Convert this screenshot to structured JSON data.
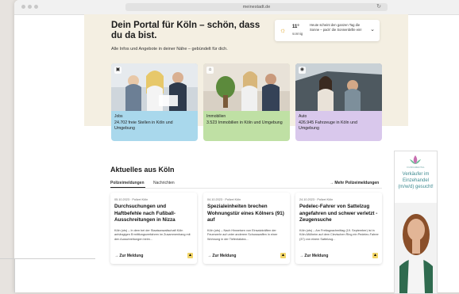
{
  "browser": {
    "url": "meinestadt.de"
  },
  "hero": {
    "title": "Dein Portal für Köln – schön, dass du da bist.",
    "subtitle": "Alle Infos und Angebote in deiner Nähe – gebündelt für dich."
  },
  "weather": {
    "temp": "11°",
    "desc": "sonnig",
    "text": "Heute scheint den ganzen Tag die Sonne – pack' die Sonnenbrille ein!"
  },
  "categories": [
    {
      "label": "Jobs",
      "desc": "24.702 freie Stellen in Köln und Umgebung",
      "color": "#a9d8ec"
    },
    {
      "label": "Immobilien",
      "desc": "3.523 Immobilien in Köln und Umgebung",
      "color": "#bfe0a4"
    },
    {
      "label": "Auto",
      "desc": "426.945 Fahrzeuge in Köln und Umgebung",
      "color": "#d9c8ec"
    }
  ],
  "news": {
    "section_title": "Aktuelles aus Köln",
    "tabs": [
      "Polizeimeldungen",
      "Nachrichten"
    ],
    "more_link": "Mehr Polizeimeldungen",
    "items": [
      {
        "meta": "05.10.2023 · Polizei Köln",
        "title": "Durchsuchungen und Haftbefehle nach Fußball-Ausschreitungen in Nizza",
        "text": "Köln (ots) – In dem bei der Staatsanwaltschaft Köln anhängigen Ermittlungsverfahren im Zusammenhang mit den Ausschreitungen beim...",
        "link": "Zur Meldung"
      },
      {
        "meta": "04.10.2023 · Polizei Köln",
        "title": "Spezialeinheiten brechen Wohnungstür eines Kölners (91) auf",
        "text": "Köln (ots) – Nach Hinweisen von Einsatzkräften der Feuerwehr auf unter anderem Schusswaffen in einer Wohnung in der Tiefentalstra...",
        "link": "Zur Meldung"
      },
      {
        "meta": "24.10.2023 · Polizei Köln",
        "title": "Pedelec-Fahrer von Sattelzug angefahren und schwer verletzt - Zeugensuche",
        "text": "Köln (ots) – Am Freitagnachmittag (19. September) ist in Köln-Mülheim auf dem Clevischen Ring ein Pedelec-Fahrer (37) von einem Sattelzug...",
        "link": "Zur Meldung"
      }
    ]
  },
  "ad": {
    "logo_text": "FUNDAMENTAL",
    "text": "Verkäufer im Einzehandel (m/w/d) gesucht!"
  }
}
